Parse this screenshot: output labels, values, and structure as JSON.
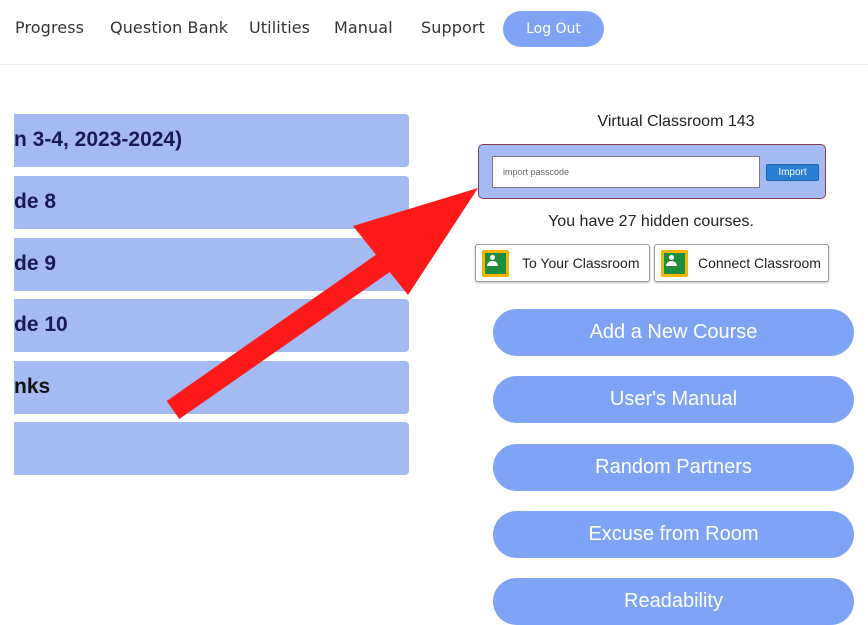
{
  "nav": {
    "items": [
      "Progress",
      "Question Bank",
      "Utilities",
      "Manual",
      "Support"
    ],
    "logout": "Log Out"
  },
  "courses": [
    "n 3-4, 2023-2024)",
    "de 8",
    "de 9",
    "de 10",
    "nks",
    ""
  ],
  "right": {
    "virtual_classroom": "Virtual Classroom 143",
    "passcode_placeholder": "import passcode",
    "import_button": "Import",
    "hidden_courses": "You have 27 hidden courses.",
    "to_classroom": "To Your Classroom",
    "connect_classroom": "Connect Classroom",
    "buttons": [
      "Add a New Course",
      "User's Manual",
      "Random Partners",
      "Excuse from Room",
      "Readability"
    ]
  },
  "colors": {
    "accent": "#7fa3f5",
    "course_bg": "#a3baf3",
    "arrow": "#ff0000"
  },
  "icons": {
    "google_classroom": "google-classroom-icon",
    "annotation_arrow": "red-arrow"
  }
}
